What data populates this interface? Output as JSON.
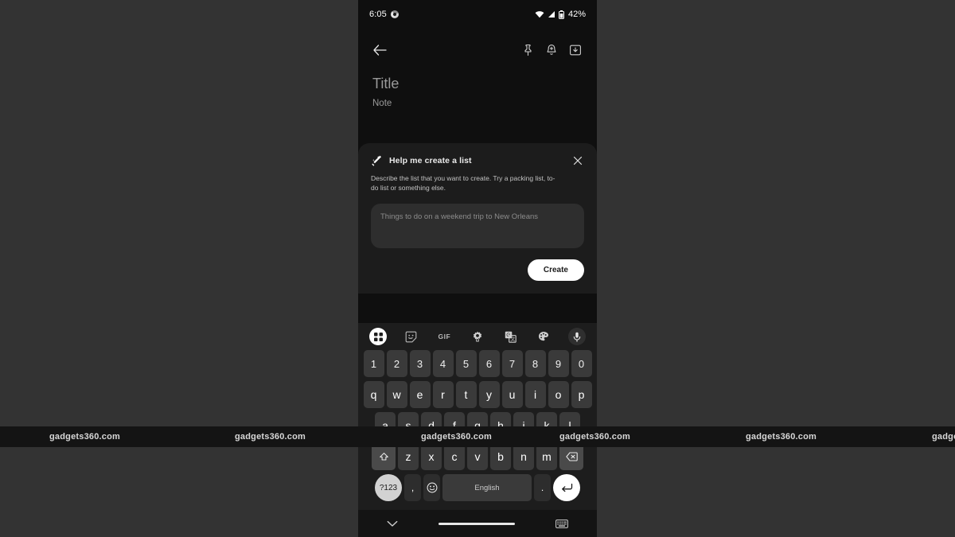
{
  "background_color": "#333333",
  "watermark": {
    "text": "gadgets360.com",
    "positions": [
      62,
      295,
      529,
      703,
      937,
      1171
    ]
  },
  "phone": {
    "status_bar": {
      "time": "6:05",
      "app_icon": "chrome-icon",
      "wifi_icon": "wifi-icon",
      "signal_icon": "cellular-signal-icon",
      "battery_icon": "battery-icon",
      "battery_text": "42%"
    },
    "toolbar": {
      "back_icon": "back-arrow-icon",
      "pin_icon": "pin-icon",
      "reminder_icon": "add-reminder-bell-icon",
      "archive_icon": "archive-icon"
    },
    "note": {
      "title_placeholder": "Title",
      "body_placeholder": "Note"
    },
    "ai_card": {
      "wand_icon": "magic-wand-icon",
      "title": "Help me create a list",
      "close_icon": "close-icon",
      "description": "Describe the list that you want to create. Try a packing list, to-do list or something else.",
      "input_placeholder": "Things to do on a weekend trip to New Orleans",
      "input_value": "",
      "create_label": "Create"
    },
    "keyboard": {
      "toolbar_icons": [
        "apps-grid-icon",
        "sticker-icon",
        "gif-icon",
        "settings-gear-icon",
        "translate-icon",
        "theme-palette-icon",
        "microphone-icon"
      ],
      "gif_label": "GIF",
      "rows": {
        "numbers": [
          "1",
          "2",
          "3",
          "4",
          "5",
          "6",
          "7",
          "8",
          "9",
          "0"
        ],
        "top": [
          "q",
          "w",
          "e",
          "r",
          "t",
          "y",
          "u",
          "i",
          "o",
          "p"
        ],
        "home": [
          "a",
          "s",
          "d",
          "f",
          "g",
          "h",
          "j",
          "k",
          "l"
        ],
        "bottom": [
          "z",
          "x",
          "c",
          "v",
          "b",
          "n",
          "m"
        ]
      },
      "shift_icon": "shift-icon",
      "backspace_icon": "backspace-icon",
      "symbols_label": "?123",
      "comma_label": ",",
      "emoji_icon": "emoji-icon",
      "space_label": "English",
      "period_label": ".",
      "enter_icon": "enter-icon"
    },
    "nav_bar": {
      "hide_keyboard_icon": "chevron-down-icon",
      "home_pill": "home-indicator",
      "switch_keyboard_icon": "keyboard-icon"
    }
  }
}
